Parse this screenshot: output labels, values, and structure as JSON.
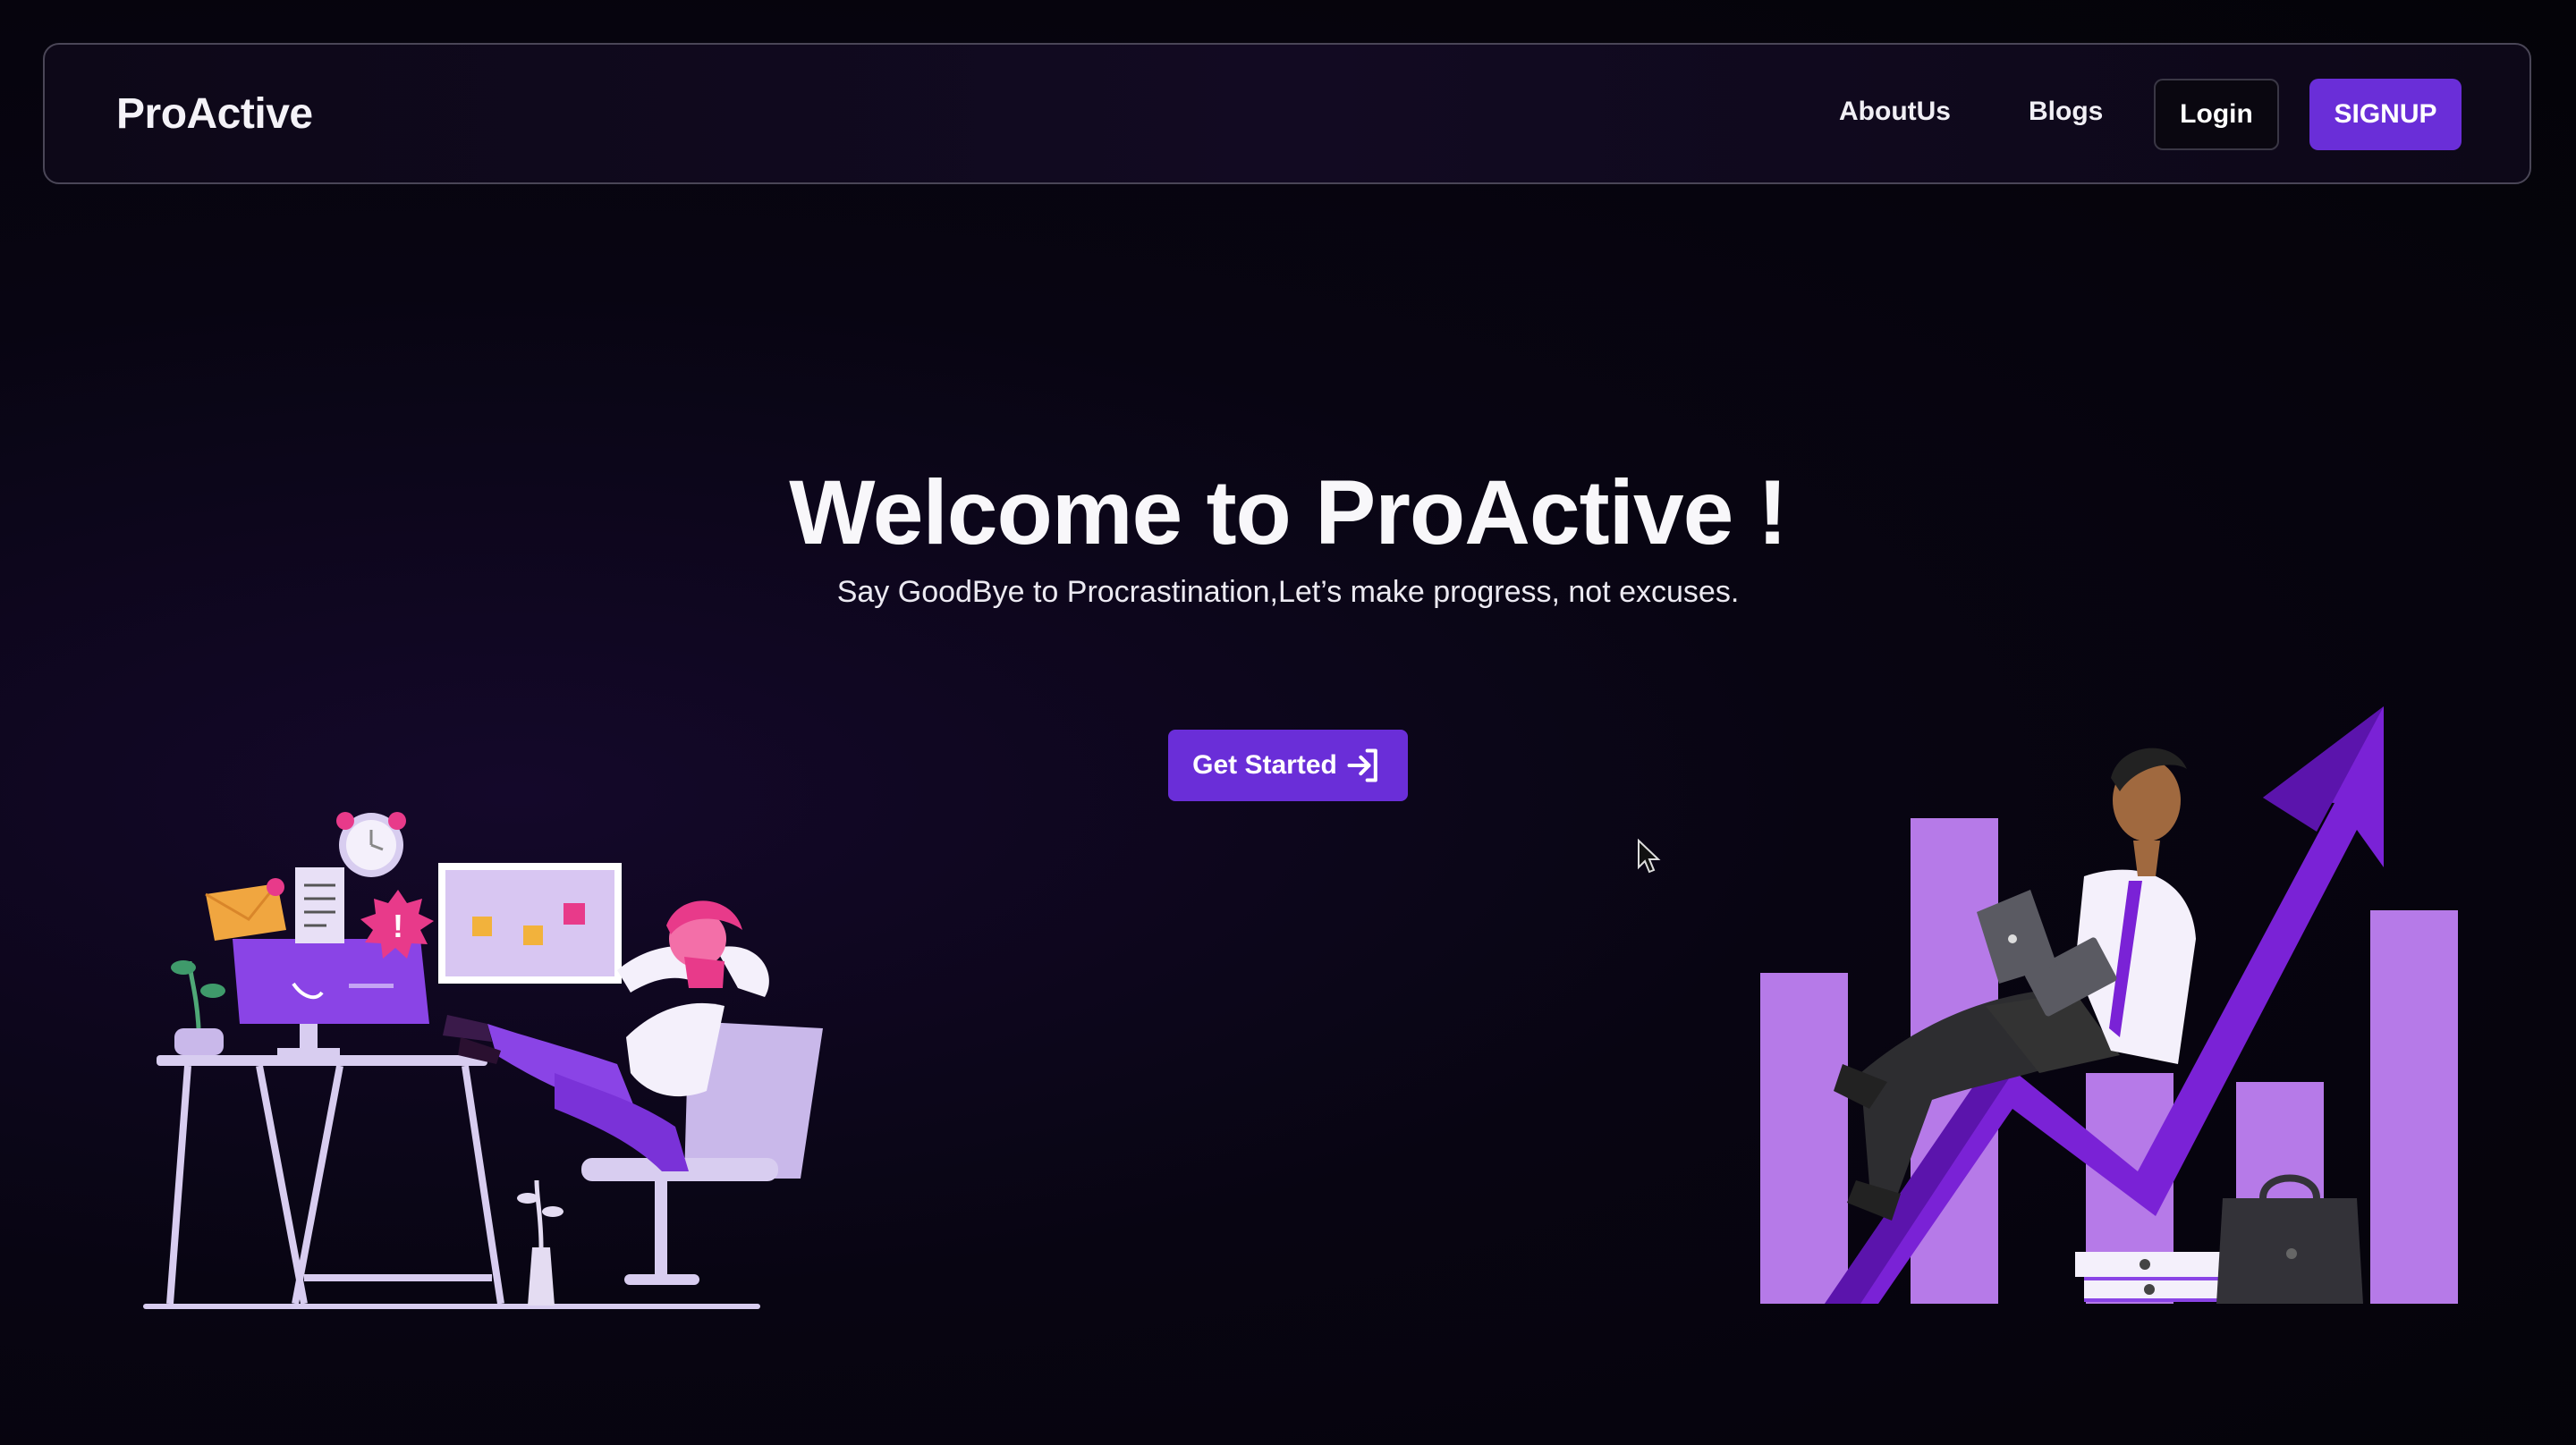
{
  "brand": "ProActive",
  "nav": {
    "about_label": "AboutUs",
    "blogs_label": "Blogs",
    "login_label": "Login",
    "signup_label": "SIGNUP"
  },
  "hero": {
    "title": "Welcome to ProActive !",
    "subtitle": "Say GoodBye to Procrastination,Let’s make progress, not excuses.",
    "cta_label": "Get Started",
    "cta_icon": "sign-in-arrow-icon"
  },
  "illustrations": {
    "left": "procrastinating-person-illustration",
    "right": "growth-chart-businessman-illustration"
  },
  "colors": {
    "accent": "#6a2ed8",
    "background": "#06040c",
    "chart_light": "#b67ae8",
    "arrow": "#7a22d6"
  }
}
